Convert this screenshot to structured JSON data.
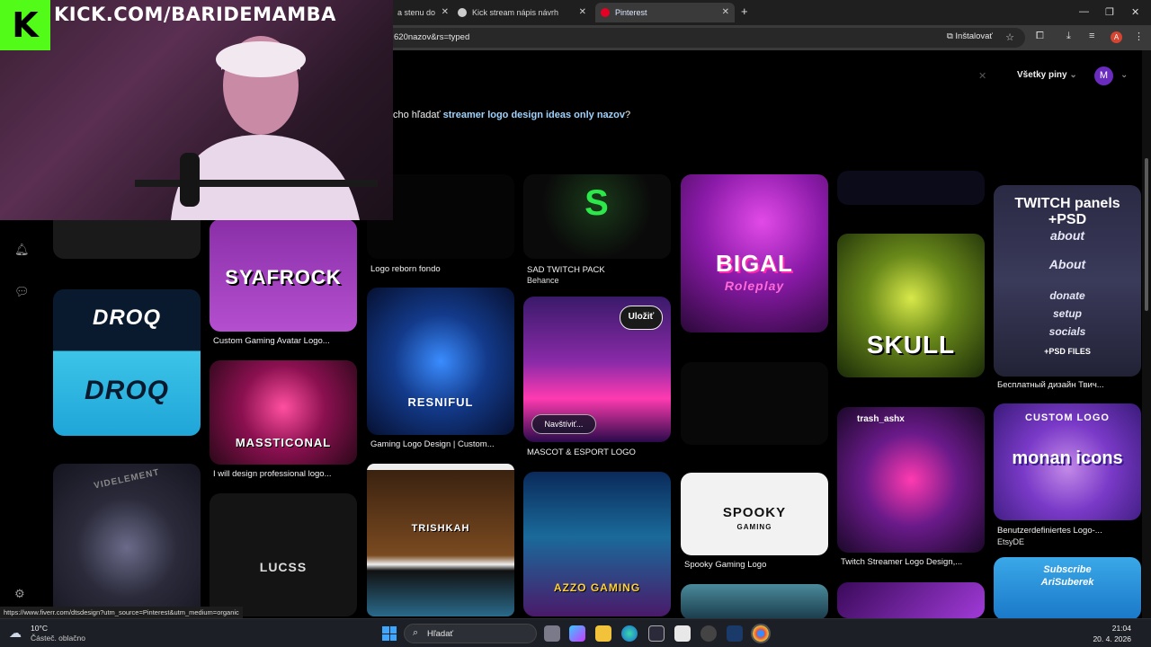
{
  "browser": {
    "tabs": [
      {
        "label": "a stenu do",
        "close": "✕"
      },
      {
        "label": "Kick stream nápis návrh",
        "close": "✕"
      },
      {
        "label": "Pinterest",
        "close": "✕"
      }
    ],
    "new_tab": "+",
    "url": "620nazov&rs=typed",
    "install_label": "Inštalovať",
    "profile_letter": "A"
  },
  "pinterest": {
    "all_pins_label": "Všetky piny",
    "avatar_letter": "M",
    "suggest_prefix": "cho hľadať",
    "suggest_query": "streamer logo design ideas only nazov",
    "suggest_suffix": "?"
  },
  "stream": {
    "kick_letter": "K",
    "channel_url": "KICK.COM/BARIDEMAMBA"
  },
  "pins": {
    "col2": [
      {
        "caption": "Custom Gaming Avatar Logo...",
        "art": "SYAFROCK"
      },
      {
        "caption": "I will design professional logo...",
        "art": "MASSTICONAL"
      },
      {
        "art": "LUCSS"
      }
    ],
    "col1": [
      {
        "art": "DROQ"
      },
      {
        "art": "DROQ"
      },
      {
        "art": "VIDELEMENT"
      }
    ],
    "col3": [
      {
        "caption": "Logo reborn fondo"
      },
      {
        "caption": "Gaming Logo Design | Custom...",
        "art": "RESNIFUL"
      },
      {
        "art": "TRISHKAH"
      }
    ],
    "col4": [
      {
        "caption": "SAD TWITCH PACK",
        "sub": "Behance"
      },
      {
        "caption": "MASCOT & ESPORT LOGO",
        "save": "Uložiť",
        "visit": "Navštíviť..."
      },
      {
        "art": "AZZO GAMING"
      }
    ],
    "col5": [
      {
        "art": "BIGAL",
        "art2": "Roleplay"
      },
      {
        "caption": "Spooky Gaming Logo",
        "art": "SPOOKY",
        "art2": "GAMING"
      }
    ],
    "col6": [
      {
        "art": "SKULL"
      },
      {
        "caption": "Twitch Streamer Logo Design,...",
        "art": "trash_ashx"
      }
    ],
    "col7": [
      {
        "caption": "Бесплатный дизайн Твич...",
        "art": "TWITCH panels +PSD",
        "lines": [
          "about",
          "About",
          "donate",
          "setup",
          "socials",
          "+PSD FILES"
        ]
      },
      {
        "caption": "Benutzerdefiniertes Logo-...",
        "sub": "EtsyDE",
        "art": "CUSTOM LOGO",
        "art2": "monan icons"
      },
      {
        "art": "Subscribe",
        "art2": "AriSuberek"
      }
    ]
  },
  "status_url": "https://www.fiverr.com/dtsdesign?utm_source=Pinterest&utm_medium=organic",
  "taskbar": {
    "temp": "10°C",
    "weather": "Částeč. oblačno",
    "search_label": "Hľadať",
    "time": "21:04",
    "date": "20. 4. 2026"
  }
}
